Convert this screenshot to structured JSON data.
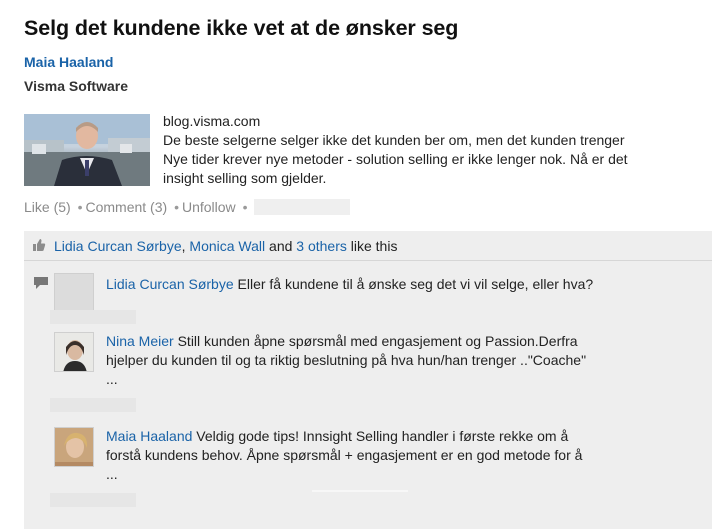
{
  "post": {
    "title": "Selg det kundene ikke vet at de ønsker seg",
    "author": "Maia Haaland",
    "company": "Visma Software"
  },
  "share": {
    "domain": "blog.visma.com",
    "lines": [
      "De beste selgerne selger ikke det kunden ber om, men det kunden trenger",
      "Nye tider krever nye metoder - solution selling er ikke lenger nok. Nå er det",
      "insight selling som gjelder."
    ]
  },
  "actions": {
    "like": "Like (5)",
    "comment": "Comment (3)",
    "unfollow": "Unfollow",
    "separator": "•"
  },
  "likes": {
    "name1": "Lidia Curcan Sørbye",
    "comma": ",",
    "name2": "Monica Wall",
    "and": " and ",
    "others": "3 others",
    "suffix": " like this"
  },
  "comments": [
    {
      "author": "Lidia Curcan Sørbye",
      "lines": [
        "Eller få kundene til å ønske seg det vi vil selge, eller hva?"
      ]
    },
    {
      "author": "Nina Meier",
      "lines": [
        "Still kunden åpne spørsmål med engasjement og Passion.Derfra",
        "hjelper du kunden til og ta riktig beslutning på hva hun/han trenger ..\"Coache\"",
        "..."
      ]
    },
    {
      "author": "Maia Haaland",
      "lines": [
        "Veldig gode tips! Innsight Selling handler i første rekke om å",
        "forstå kundens behov. Åpne spørsmål + engasjement er en god metode for å",
        "..."
      ]
    }
  ],
  "colors": {
    "link": "#1a63a8",
    "panel": "#eeeeee",
    "muted": "#8a8a8a"
  },
  "icons": [
    "thumbs-up-icon",
    "comment-icon"
  ]
}
